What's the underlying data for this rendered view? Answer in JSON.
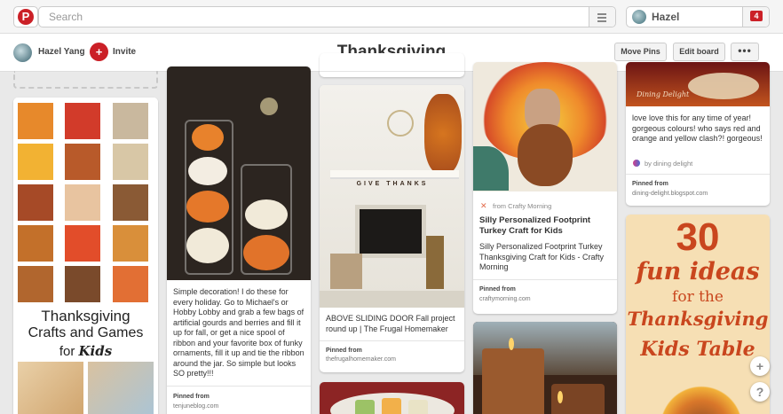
{
  "topbar": {
    "logo_letter": "P",
    "search_placeholder": "Search",
    "user_name": "Hazel",
    "notification_count": "4"
  },
  "board": {
    "owner_name": "Hazel Yang",
    "invite_label": "Invite",
    "title": "Thanksgiving",
    "move_pins_label": "Move Pins",
    "edit_board_label": "Edit board",
    "more_label": "•••"
  },
  "pins": {
    "collage": {
      "line1": "Thanksgiving",
      "line2": "Crafts and Games",
      "line3a": "for",
      "line3b": "Kids"
    },
    "pumpkins": {
      "description": "Simple decoration! I do these for every holiday. Go to Michael's or Hobby Lobby and grab a few bags of artificial gourds and berries and fill it up for fall, or get a nice spool of ribbon and your favorite box of funky ornaments, fill it up and tie the ribbon around the jar. So simple but looks SO pretty!!!",
      "pinned_from_label": "Pinned from",
      "source": "tenjuneblog.com"
    },
    "mantel": {
      "banner_text": "GIVE THANKS",
      "description": "ABOVE SLIDING DOOR Fall project round up | The Frugal Homemaker",
      "pinned_from_label": "Pinned from",
      "source": "thefrugalhomemaker.com"
    },
    "turkey_craft": {
      "from_label": "from Crafty Morning",
      "title": "Silly Personalized Footprint Turkey Craft for Kids",
      "description": "Silly Personalized Footprint Turkey Thanksgiving Craft for Kids - Crafty Morning",
      "pinned_from_label": "Pinned from",
      "source": "craftymorning.com"
    },
    "dining": {
      "watermark": "Dining Delight",
      "description": "love love this for any time of year! gorgeous colours! who says red and orange and yellow clash?! gorgeous!",
      "by_label": "by dining delight",
      "pinned_from_label": "Pinned from",
      "source": "dining-delight.blogspot.com"
    },
    "kids_table": {
      "line1": "30",
      "line2": "fun ideas",
      "line3": "for the",
      "line4": "Thanksgiving",
      "line5": "Kids Table"
    }
  },
  "floating": {
    "add_label": "+",
    "help_label": "?"
  },
  "colors": {
    "brand_red": "#cb2027",
    "background": "#e9e9e9"
  }
}
